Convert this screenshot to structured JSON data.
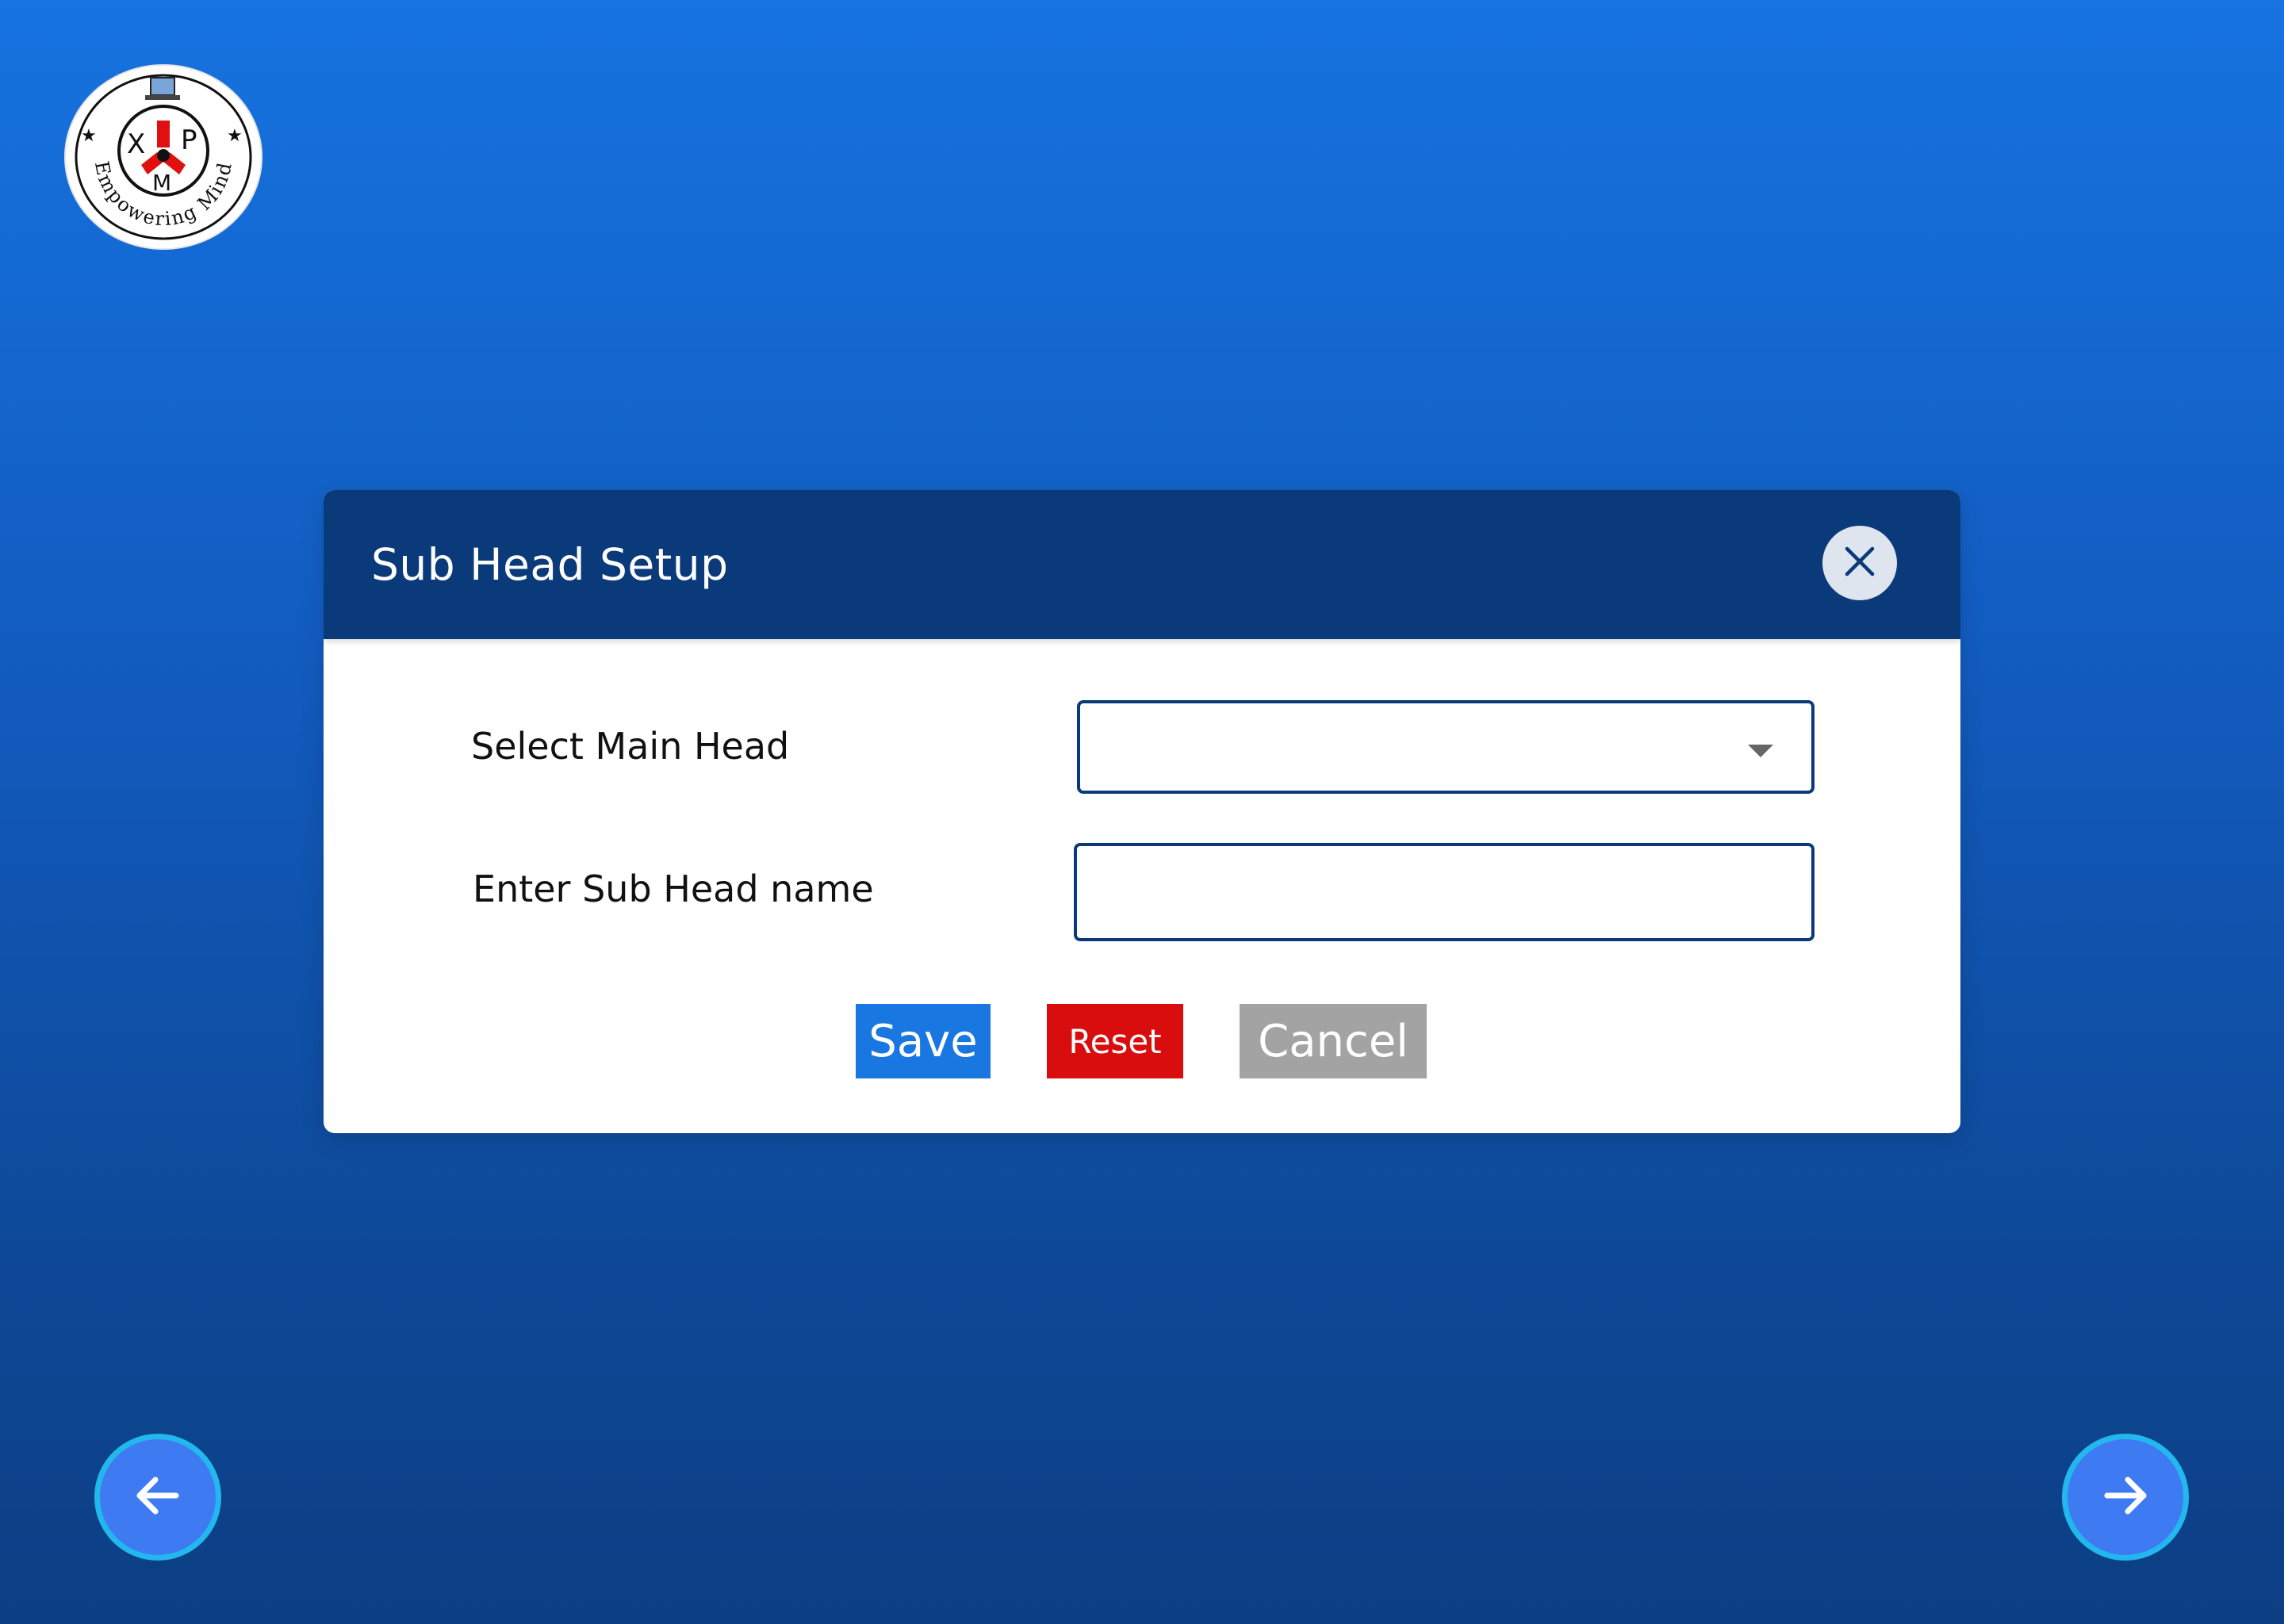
{
  "logo": {
    "letters": [
      "X",
      "P",
      "M"
    ],
    "tagline": "Empowering Mind"
  },
  "dialog": {
    "title": "Sub Head Setup",
    "close_icon": "close-icon"
  },
  "form": {
    "main_head_label": "Select Main Head",
    "main_head_value": "",
    "sub_head_label": "Enter Sub Head name",
    "sub_head_value": "",
    "sub_head_placeholder": ""
  },
  "buttons": {
    "save": "Save",
    "reset": "Reset",
    "cancel": "Cancel"
  },
  "navigation": {
    "prev_icon": "arrow-left-icon",
    "next_icon": "arrow-right-icon"
  },
  "colors": {
    "header": "#0b3a7a",
    "save": "#1877e0",
    "reset": "#d90d0d",
    "cancel": "#a3a3a3",
    "nav_fill": "#3e7bf2",
    "nav_ring": "#22b8ee"
  }
}
